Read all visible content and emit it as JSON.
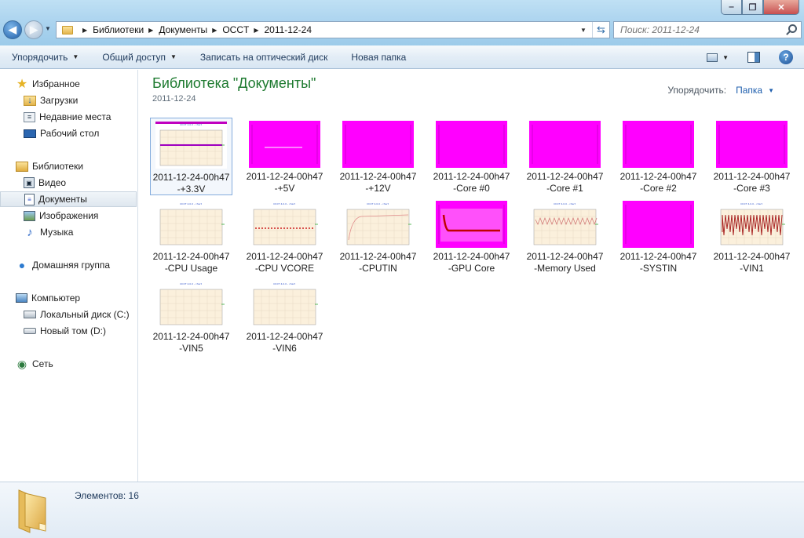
{
  "window": {
    "minimize_label": "‒",
    "maximize_label": "❐",
    "close_label": "✕"
  },
  "nav": {
    "back_label": "◀",
    "forward_label": "▶"
  },
  "address": {
    "crumbs": [
      "Библиотеки",
      "Документы",
      "OCCT",
      "2011-12-24"
    ]
  },
  "search": {
    "placeholder": "Поиск: 2011-12-24"
  },
  "toolbar": {
    "organize": "Упорядочить",
    "share": "Общий доступ",
    "burn": "Записать на оптический диск",
    "new_folder": "Новая папка",
    "help": "?"
  },
  "sidebar": {
    "favorites": "Избранное",
    "downloads": "Загрузки",
    "recent": "Недавние места",
    "desktop": "Рабочий стол",
    "libraries": "Библиотеки",
    "video": "Видео",
    "documents": "Документы",
    "pictures": "Изображения",
    "music": "Музыка",
    "homegroup": "Домашняя группа",
    "computer": "Компьютер",
    "local_disk": "Локальный диск (C:)",
    "new_volume": "Новый том (D:)",
    "network": "Сеть"
  },
  "main": {
    "title": "Библиотека \"Документы\"",
    "subtitle": "2011-12-24",
    "arrange_label": "Упорядочить:",
    "arrange_value": "Папка"
  },
  "files": [
    {
      "name": "2011-12-24-00h47-+3.3V",
      "thumb": "pink-bar"
    },
    {
      "name": "2011-12-24-00h47-+5V",
      "thumb": "magenta-line"
    },
    {
      "name": "2011-12-24-00h47-+12V",
      "thumb": "magenta"
    },
    {
      "name": "2011-12-24-00h47-Core #0",
      "thumb": "magenta"
    },
    {
      "name": "2011-12-24-00h47-Core #1",
      "thumb": "magenta"
    },
    {
      "name": "2011-12-24-00h47-Core #2",
      "thumb": "magenta"
    },
    {
      "name": "2011-12-24-00h47-Core #3",
      "thumb": "magenta"
    },
    {
      "name": "2011-12-24-00h47-CPU Usage",
      "thumb": "beige"
    },
    {
      "name": "2011-12-24-00h47-CPU VCORE",
      "thumb": "beige-dots"
    },
    {
      "name": "2011-12-24-00h47-CPUTIN",
      "thumb": "beige-curve"
    },
    {
      "name": "2011-12-24-00h47-GPU Core",
      "thumb": "magenta-gpu"
    },
    {
      "name": "2011-12-24-00h47-Memory Used",
      "thumb": "beige-wave"
    },
    {
      "name": "2011-12-24-00h47-SYSTIN",
      "thumb": "magenta"
    },
    {
      "name": "2011-12-24-00h47-VIN1",
      "thumb": "beige-noise"
    },
    {
      "name": "2011-12-24-00h47-VIN5",
      "thumb": "beige"
    },
    {
      "name": "2011-12-24-00h47-VIN6",
      "thumb": "beige"
    }
  ],
  "details": {
    "count": "Элементов: 16"
  },
  "colors": {
    "title_green": "#1d7a2f",
    "link_blue": "#1f5fae",
    "magenta": "#ff00ff",
    "beige": "#fbf0dc"
  }
}
